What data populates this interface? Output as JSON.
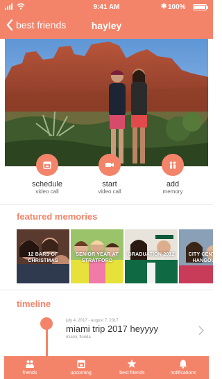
{
  "colors": {
    "accent": "#f3846a",
    "text": "#333333",
    "muted": "#999999"
  },
  "status_bar": {
    "time": "9:41 AM",
    "battery": "100%"
  },
  "nav": {
    "back_label": "best friends",
    "title": "hayley"
  },
  "actions": [
    {
      "label": "schedule",
      "sub": "video call",
      "icon": "calendar-icon"
    },
    {
      "label": "start",
      "sub": "video call",
      "icon": "video-camera-icon"
    },
    {
      "label": "add",
      "sub": "memory",
      "icon": "people-icon"
    }
  ],
  "featured": {
    "title": "featured memories",
    "items": [
      {
        "caption": "12 BARS OF CHRISTMAS"
      },
      {
        "caption": "SENIOR YEAR AT STRATFORD"
      },
      {
        "caption": "GRADUATION 2012"
      },
      {
        "caption": "CITY CENTER HANGOUT"
      }
    ]
  },
  "timeline": {
    "title": "timeline",
    "items": [
      {
        "dates": "july 4, 2017 - august 7, 2017",
        "name": "miami trip 2017 heyyyy",
        "place": "miami, florida"
      }
    ]
  },
  "tabs": [
    {
      "label": "friends",
      "icon": "friends-icon"
    },
    {
      "label": "upcoming",
      "icon": "calendar-icon"
    },
    {
      "label": "best friends",
      "icon": "star-icon"
    },
    {
      "label": "notifications",
      "icon": "bell-icon"
    }
  ]
}
